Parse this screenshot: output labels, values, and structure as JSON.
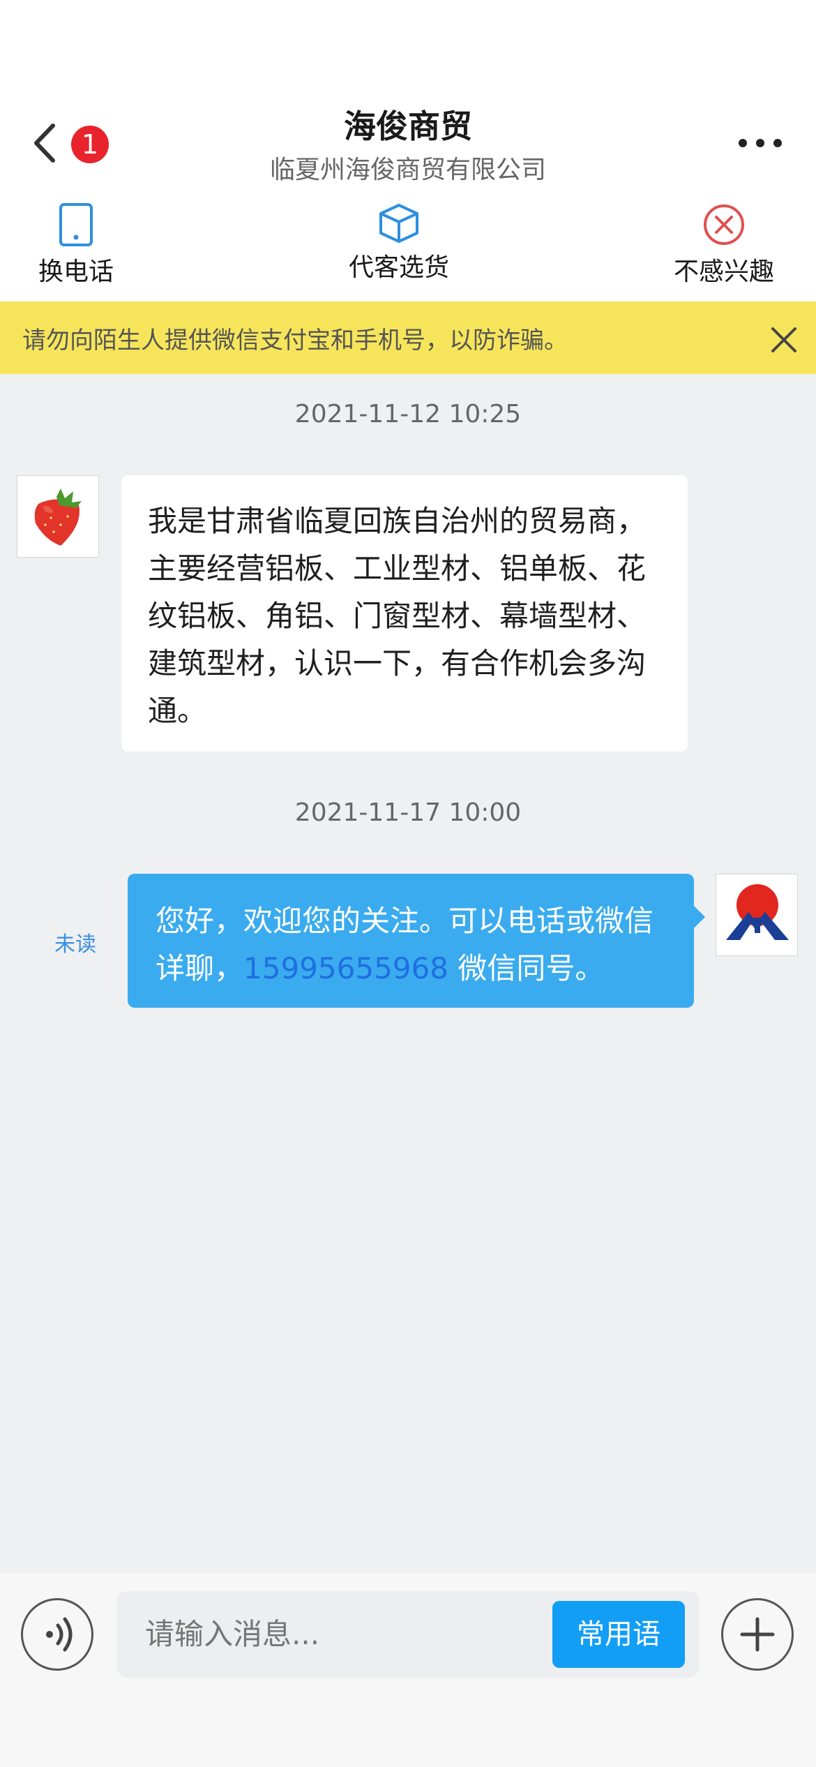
{
  "header": {
    "title": "海俊商贸",
    "subtitle": "临夏州海俊商贸有限公司",
    "unread_badge": "1"
  },
  "actions": [
    {
      "label": "换电话",
      "icon": "phone-icon"
    },
    {
      "label": "代客选货",
      "icon": "box-icon"
    },
    {
      "label": "不感兴趣",
      "icon": "close-circle-icon"
    }
  ],
  "notice": {
    "text": "请勿向陌生人提供微信支付宝和手机号，以防诈骗。",
    "close_icon": "close-icon"
  },
  "messages": [
    {
      "time": "2021-11-12 10:25",
      "direction": "incoming",
      "avatar": "strawberry-avatar",
      "text": "我是甘肃省临夏回族自治州的贸易商，主要经营铝板、工业型材、铝单板、花纹铝板、角铝、门窗型材、幕墙型材、建筑型材，认识一下，有合作机会多沟通。"
    },
    {
      "time": "2021-11-17 10:00",
      "direction": "outgoing",
      "avatar": "company-logo-avatar",
      "status": "未读",
      "text_before": "您好，欢迎您的关注。可以电话或微信详聊，",
      "phone": "15995655968",
      "text_after": " 微信同号。"
    }
  ],
  "input": {
    "placeholder": "请输入消息...",
    "phrase_button": "常用语"
  },
  "colors": {
    "accent": "#139ef5",
    "outgoing_bubble": "#3aabef",
    "notice_bg": "#f6e55b",
    "badge": "#e8232c",
    "background": "#eff0f2"
  }
}
